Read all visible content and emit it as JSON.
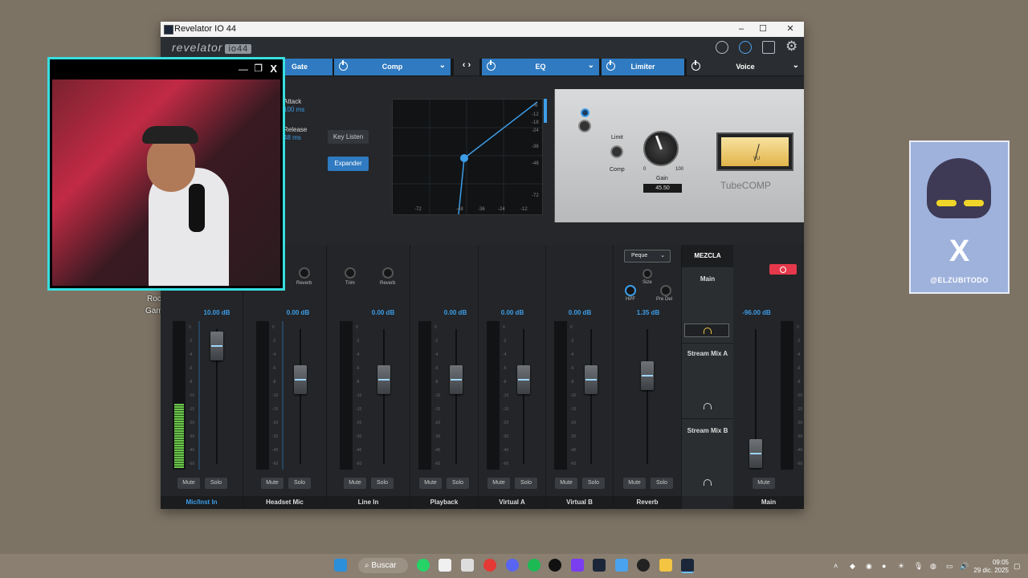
{
  "desktop": {
    "labels": [
      "Roc",
      "Gam"
    ]
  },
  "window": {
    "title": "Revelator IO 44",
    "min": "–",
    "max": "☐",
    "close": "✕"
  },
  "header": {
    "logo": "revelator",
    "logo_badge": "io44"
  },
  "fx_tabs": [
    {
      "label": "Gate"
    },
    {
      "label": "Comp"
    },
    {
      "label": "EQ"
    },
    {
      "label": "Limiter"
    },
    {
      "label": "Voice"
    }
  ],
  "fx": {
    "attack_label": "Attack",
    "attack_value": "100 ms",
    "release_label": "Release",
    "release_value": "48 ms",
    "key_listen": "Key Listen",
    "expander": "Expander",
    "graph_y": [
      "-6",
      "-12",
      "-18",
      "-24",
      "-36",
      "-48",
      "-72"
    ],
    "graph_x": [
      "-72",
      "-48",
      "-36",
      "-24",
      "-12"
    ],
    "limit_label": "Limit",
    "comp_label": "Comp",
    "gain_label": "Gain",
    "gain_min": "0",
    "gain_max": "100",
    "gain_value": "45.50",
    "vu_label": "VU",
    "tube_brand": "TubeCOMP"
  },
  "channels": [
    {
      "name": "Mic/Inst In",
      "db": "10.00 dB",
      "mute": "Mute",
      "solo": "Solo",
      "fader_level": 0.05
    },
    {
      "name": "Headset Mic",
      "db": "0.00 dB",
      "mute": "Mute",
      "solo": "Solo",
      "fader_level": 0.3,
      "knob": "Reverb"
    },
    {
      "name": "Line In",
      "db": "0.00 dB",
      "mute": "Mute",
      "solo": "Solo",
      "fader_level": 0.3,
      "knob_a": "Trim",
      "knob_b": "Reverb"
    },
    {
      "name": "Playback",
      "db": "0.00 dB",
      "mute": "Mute",
      "solo": "Solo",
      "fader_level": 0.3
    },
    {
      "name": "Virtual A",
      "db": "0.00 dB",
      "mute": "Mute",
      "solo": "Solo",
      "fader_level": 0.3
    },
    {
      "name": "Virtual B",
      "db": "0.00 dB",
      "mute": "Mute",
      "solo": "Solo",
      "fader_level": 0.3
    },
    {
      "name": "Reverb",
      "db": "1.35 dB",
      "mute": "Mute",
      "solo": "Solo",
      "fader_level": 0.27,
      "preset": "Peque",
      "size": "Size",
      "hpf": "HPF",
      "predel": "Pre Del"
    }
  ],
  "mix": {
    "title": "MEZCLA",
    "main": "Main",
    "stream_a": "Stream Mix A",
    "stream_b": "Stream Mix B"
  },
  "main_ch": {
    "name": "Main",
    "db": "-96.00 dB",
    "mute": "Mute"
  },
  "scale": [
    "0",
    "-2",
    "-4",
    "-6",
    "-8",
    "-10",
    "-15",
    "-20",
    "-30",
    "-40",
    "-60"
  ],
  "card": {
    "handle": "@ELZUBITODO"
  },
  "taskbar": {
    "search": "Buscar",
    "time": "09:05",
    "date": "29 dic. 2025"
  }
}
